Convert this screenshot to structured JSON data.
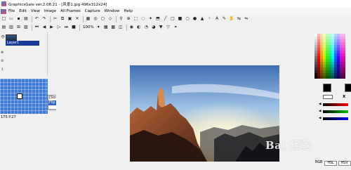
{
  "window": {
    "title": "GraphicsGale ver.2.08.21 - [风景1.jpg 496x312x24]"
  },
  "menu": {
    "items": [
      "File",
      "Edit",
      "View",
      "Image",
      "All Frames",
      "Capture",
      "Window",
      "Help"
    ]
  },
  "toolbar": {
    "zoom": "100%",
    "tb1_icons": [
      "new-icon",
      "open-icon",
      "save-icon",
      "undo-icon",
      "redo-icon",
      "cut-icon",
      "copy-icon",
      "paste-icon",
      "delete-icon",
      "grid-icon",
      "onion-icon",
      "zoom-icon",
      "magnify-icon",
      "select-rect-icon",
      "select-lasso-icon",
      "select-magic-icon",
      "fill-icon",
      "line-icon",
      "rect-icon",
      "filled-rect-icon",
      "ellipse-icon",
      "filled-ellipse-icon",
      "brush-icon",
      "spray-icon",
      "text-icon",
      "picker-icon",
      "hand-icon"
    ],
    "tb2_icons": [
      "layer-icon",
      "frame-icon",
      "add-frame-icon",
      "play-first-icon",
      "play-prev-icon",
      "play-icon",
      "play-next-icon",
      "play-last-icon",
      "stop-icon",
      "pause-icon",
      "loop-icon",
      "timer-icon",
      "preview-icon",
      "palette-icon",
      "color-icon",
      "brush-size-icon"
    ]
  },
  "layers": {
    "layer_name": "Layer1"
  },
  "status": {
    "coords": "175:Y:27"
  },
  "popup": {
    "items": [
      "[Stof Edit]",
      "Flip Horizontal[All Frames]"
    ]
  },
  "palette": {
    "fg_color": "#000000",
    "bg_color": "#000000",
    "x_label": "X",
    "mode_label": "RGB",
    "modes": [
      "HSL",
      "HSV"
    ]
  },
  "watermark": {
    "text": "Bai 经验"
  }
}
